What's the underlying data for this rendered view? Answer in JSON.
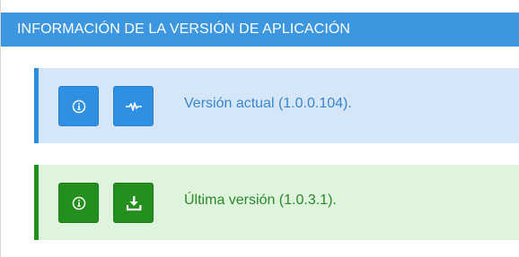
{
  "panel": {
    "title": "INFORMACIÓN DE LA VERSIÓN DE APLICACIÓN"
  },
  "alerts": [
    {
      "type": "info",
      "text": "Versión actual (1.0.0.104).",
      "buttons": [
        {
          "icon": "info-circle-icon"
        },
        {
          "icon": "pulse-icon"
        }
      ]
    },
    {
      "type": "success",
      "text": "Última versión (1.0.3.1).",
      "buttons": [
        {
          "icon": "info-circle-icon"
        },
        {
          "icon": "download-icon"
        }
      ]
    }
  ],
  "colors": {
    "header": "#3c97e0",
    "info_bg": "#d4e6f8",
    "info_accent": "#2a8ee0",
    "success_bg": "#dff4dc",
    "success_accent": "#21901f"
  }
}
